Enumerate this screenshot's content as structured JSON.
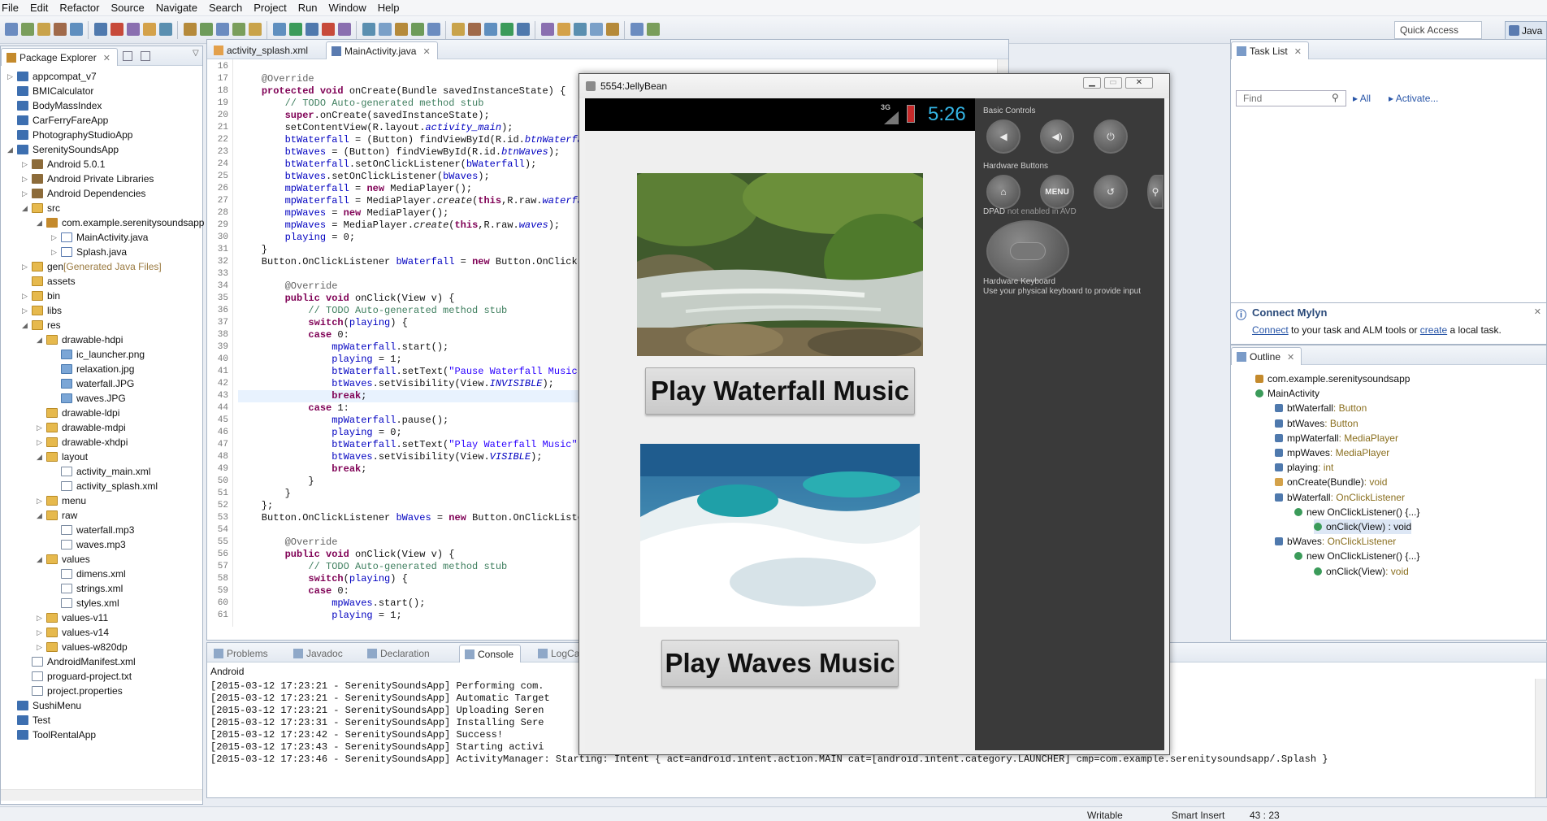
{
  "menubar": [
    "File",
    "Edit",
    "Refactor",
    "Source",
    "Navigate",
    "Search",
    "Project",
    "Run",
    "Window",
    "Help"
  ],
  "toolbar": {
    "quick_access": "Quick Access",
    "perspective": "Java"
  },
  "package_explorer": {
    "title": "Package Explorer",
    "items": [
      {
        "label": "appcompat_v7",
        "depth": 0,
        "icon": "proj",
        "arrow": "▷"
      },
      {
        "label": "BMICalculator",
        "depth": 0,
        "icon": "proj",
        "arrow": ""
      },
      {
        "label": "BodyMassIndex",
        "depth": 0,
        "icon": "proj",
        "arrow": ""
      },
      {
        "label": "CarFerryFareApp",
        "depth": 0,
        "icon": "proj",
        "arrow": ""
      },
      {
        "label": "PhotographyStudioApp",
        "depth": 0,
        "icon": "proj",
        "arrow": ""
      },
      {
        "label": "SerenitySoundsApp",
        "depth": 0,
        "icon": "proj",
        "arrow": "◢"
      },
      {
        "label": "Android 5.0.1",
        "depth": 1,
        "icon": "lib",
        "arrow": "▷"
      },
      {
        "label": "Android Private Libraries",
        "depth": 1,
        "icon": "lib",
        "arrow": "▷"
      },
      {
        "label": "Android Dependencies",
        "depth": 1,
        "icon": "lib",
        "arrow": "▷"
      },
      {
        "label": "src",
        "depth": 1,
        "icon": "folder",
        "arrow": "◢"
      },
      {
        "label": "com.example.serenitysoundsapp",
        "depth": 2,
        "icon": "pkg",
        "arrow": "◢"
      },
      {
        "label": "MainActivity.java",
        "depth": 3,
        "icon": "jfile",
        "arrow": "▷"
      },
      {
        "label": "Splash.java",
        "depth": 3,
        "icon": "jfile",
        "arrow": "▷"
      },
      {
        "label": "gen",
        "suffix": " [Generated Java Files]",
        "depth": 1,
        "icon": "folder",
        "arrow": "▷"
      },
      {
        "label": "assets",
        "depth": 1,
        "icon": "folder",
        "arrow": ""
      },
      {
        "label": "bin",
        "depth": 1,
        "icon": "folder",
        "arrow": "▷"
      },
      {
        "label": "libs",
        "depth": 1,
        "icon": "folder",
        "arrow": "▷"
      },
      {
        "label": "res",
        "depth": 1,
        "icon": "folder",
        "arrow": "◢"
      },
      {
        "label": "drawable-hdpi",
        "depth": 2,
        "icon": "folder",
        "arrow": "◢"
      },
      {
        "label": "ic_launcher.png",
        "depth": 3,
        "icon": "img",
        "arrow": ""
      },
      {
        "label": "relaxation.jpg",
        "depth": 3,
        "icon": "img",
        "arrow": ""
      },
      {
        "label": "waterfall.JPG",
        "depth": 3,
        "icon": "img",
        "arrow": ""
      },
      {
        "label": "waves.JPG",
        "depth": 3,
        "icon": "img",
        "arrow": ""
      },
      {
        "label": "drawable-ldpi",
        "depth": 2,
        "icon": "folder",
        "arrow": ""
      },
      {
        "label": "drawable-mdpi",
        "depth": 2,
        "icon": "folder",
        "arrow": "▷"
      },
      {
        "label": "drawable-xhdpi",
        "depth": 2,
        "icon": "folder",
        "arrow": "▷"
      },
      {
        "label": "layout",
        "depth": 2,
        "icon": "folder",
        "arrow": "◢"
      },
      {
        "label": "activity_main.xml",
        "depth": 3,
        "icon": "file",
        "arrow": ""
      },
      {
        "label": "activity_splash.xml",
        "depth": 3,
        "icon": "file",
        "arrow": ""
      },
      {
        "label": "menu",
        "depth": 2,
        "icon": "folder",
        "arrow": "▷"
      },
      {
        "label": "raw",
        "depth": 2,
        "icon": "folder",
        "arrow": "◢"
      },
      {
        "label": "waterfall.mp3",
        "depth": 3,
        "icon": "file",
        "arrow": ""
      },
      {
        "label": "waves.mp3",
        "depth": 3,
        "icon": "file",
        "arrow": ""
      },
      {
        "label": "values",
        "depth": 2,
        "icon": "folder",
        "arrow": "◢"
      },
      {
        "label": "dimens.xml",
        "depth": 3,
        "icon": "file",
        "arrow": ""
      },
      {
        "label": "strings.xml",
        "depth": 3,
        "icon": "file",
        "arrow": ""
      },
      {
        "label": "styles.xml",
        "depth": 3,
        "icon": "file",
        "arrow": ""
      },
      {
        "label": "values-v11",
        "depth": 2,
        "icon": "folder",
        "arrow": "▷"
      },
      {
        "label": "values-v14",
        "depth": 2,
        "icon": "folder",
        "arrow": "▷"
      },
      {
        "label": "values-w820dp",
        "depth": 2,
        "icon": "folder",
        "arrow": "▷"
      },
      {
        "label": "AndroidManifest.xml",
        "depth": 1,
        "icon": "file",
        "arrow": ""
      },
      {
        "label": "proguard-project.txt",
        "depth": 1,
        "icon": "file",
        "arrow": ""
      },
      {
        "label": "project.properties",
        "depth": 1,
        "icon": "file",
        "arrow": ""
      },
      {
        "label": "SushiMenu",
        "depth": 0,
        "icon": "proj",
        "arrow": ""
      },
      {
        "label": "Test",
        "depth": 0,
        "icon": "proj",
        "arrow": ""
      },
      {
        "label": "ToolRentalApp",
        "depth": 0,
        "icon": "proj",
        "arrow": ""
      }
    ]
  },
  "editor": {
    "tabs": [
      {
        "label": "activity_splash.xml"
      },
      {
        "label": "MainActivity.java"
      }
    ],
    "lines": [
      {
        "n": "16",
        "html": ""
      },
      {
        "n": "17",
        "html": "    <span class='an'>@Override</span>"
      },
      {
        "n": "18",
        "html": "    <span class='kw'>protected void</span> onCreate(Bundle savedInstanceState) {"
      },
      {
        "n": "19",
        "html": "        <span class='cm'>// TODO Auto-generated method stub</span>"
      },
      {
        "n": "20",
        "html": "        <span class='kw'>super</span>.onCreate(savedInstanceState);"
      },
      {
        "n": "21",
        "html": "        setContentView(R.layout.<span class='fld it'>activity_main</span>);"
      },
      {
        "n": "22",
        "html": "        <span class='fld'>btWaterfall</span> = (Button) findViewById(R.id.<span class='fld it'>btnWaterfall</span>);"
      },
      {
        "n": "23",
        "html": "        <span class='fld'>btWaves</span> = (Button) findViewById(R.id.<span class='fld it'>btnWaves</span>);"
      },
      {
        "n": "24",
        "html": "        <span class='fld'>btWaterfall</span>.setOnClickListener(<span class='fld'>bWaterfall</span>);"
      },
      {
        "n": "25",
        "html": "        <span class='fld'>btWaves</span>.setOnClickListener(<span class='fld'>bWaves</span>);"
      },
      {
        "n": "26",
        "html": "        <span class='fld'>mpWaterfall</span> = <span class='kw'>new</span> MediaPlayer();"
      },
      {
        "n": "27",
        "html": "        <span class='fld'>mpWaterfall</span> = MediaPlayer.<span class='it'>create</span>(<span class='kw'>this</span>,R.raw.<span class='fld it'>waterfall</span>);"
      },
      {
        "n": "28",
        "html": "        <span class='fld'>mpWaves</span> = <span class='kw'>new</span> MediaPlayer();"
      },
      {
        "n": "29",
        "html": "        <span class='fld'>mpWaves</span> = MediaPlayer.<span class='it'>create</span>(<span class='kw'>this</span>,R.raw.<span class='fld it'>waves</span>);"
      },
      {
        "n": "30",
        "html": "        <span class='fld'>playing</span> = 0;"
      },
      {
        "n": "31",
        "html": "    }"
      },
      {
        "n": "32",
        "html": "    Button.OnClickListener <span class='fld'>bWaterfall</span> = <span class='kw'>new</span> Button.OnClickListener() {"
      },
      {
        "n": "33",
        "html": ""
      },
      {
        "n": "34",
        "html": "        <span class='an'>@Override</span>"
      },
      {
        "n": "35",
        "html": "        <span class='kw'>public void</span> onClick(View v) {"
      },
      {
        "n": "36",
        "html": "            <span class='cm'>// TODO Auto-generated method stub</span>"
      },
      {
        "n": "37",
        "html": "            <span class='kw'>switch</span>(<span class='fld'>playing</span>) {"
      },
      {
        "n": "38",
        "html": "            <span class='kw'>case</span> 0:"
      },
      {
        "n": "39",
        "html": "                <span class='fld'>mpWaterfall</span>.start();"
      },
      {
        "n": "40",
        "html": "                <span class='fld'>playing</span> = 1;"
      },
      {
        "n": "41",
        "html": "                <span class='fld'>btWaterfall</span>.setText(<span class='str'>\"Pause Waterfall Music\"</span>);"
      },
      {
        "n": "42",
        "html": "                <span class='fld'>btWaves</span>.setVisibility(View.<span class='fld it'>INVISIBLE</span>);"
      },
      {
        "n": "43",
        "html": "                <span class='kw'>break</span>;"
      },
      {
        "n": "44",
        "html": "            <span class='kw'>case</span> 1:"
      },
      {
        "n": "45",
        "html": "                <span class='fld'>mpWaterfall</span>.pause();"
      },
      {
        "n": "46",
        "html": "                <span class='fld'>playing</span> = 0;"
      },
      {
        "n": "47",
        "html": "                <span class='fld'>btWaterfall</span>.setText(<span class='str'>\"Play Waterfall Music\"</span>);"
      },
      {
        "n": "48",
        "html": "                <span class='fld'>btWaves</span>.setVisibility(View.<span class='fld it'>VISIBLE</span>);"
      },
      {
        "n": "49",
        "html": "                <span class='kw'>break</span>;"
      },
      {
        "n": "50",
        "html": "            }"
      },
      {
        "n": "51",
        "html": "        }"
      },
      {
        "n": "52",
        "html": "    };"
      },
      {
        "n": "53",
        "html": "    Button.OnClickListener <span class='fld'>bWaves</span> = <span class='kw'>new</span> Button.OnClickListener() {"
      },
      {
        "n": "54",
        "html": ""
      },
      {
        "n": "55",
        "html": "        <span class='an'>@Override</span>"
      },
      {
        "n": "56",
        "html": "        <span class='kw'>public void</span> onClick(View v) {"
      },
      {
        "n": "57",
        "html": "            <span class='cm'>// TODO Auto-generated method stub</span>"
      },
      {
        "n": "58",
        "html": "            <span class='kw'>switch</span>(<span class='fld'>playing</span>) {"
      },
      {
        "n": "59",
        "html": "            <span class='kw'>case</span> 0:"
      },
      {
        "n": "60",
        "html": "                <span class='fld'>mpWaves</span>.start();"
      },
      {
        "n": "61",
        "html": "                <span class='fld'>playing</span> = 1;"
      }
    ]
  },
  "emulator": {
    "title": "5554:JellyBean",
    "clock": "5:26",
    "network": "3G",
    "button1": "Play Waterfall Music",
    "button2": "Play Waves Music",
    "basic_controls": "Basic Controls",
    "hardware_buttons": "Hardware Buttons",
    "menu_label": "MENU",
    "dpad": "DPAD",
    "dpad_note": " not enabled in AVD",
    "hw_keyboard": "Hardware Keyboard",
    "hw_keyboard_note": "Use your physical keyboard to provide input"
  },
  "tasklist": {
    "title": "Task List",
    "find_placeholder": "Find",
    "all": "All",
    "activate": "Activate..."
  },
  "mylyn": {
    "title": "Connect Mylyn",
    "connect": "Connect",
    "middle": " to your task and ALM tools or ",
    "create": "create",
    "end": " a local task."
  },
  "outline": {
    "title": "Outline",
    "items": [
      {
        "label": "com.example.serenitysoundsapp",
        "type": "",
        "depth": 0,
        "icon": "pkg"
      },
      {
        "label": "MainActivity",
        "type": "",
        "depth": 0,
        "icon": "class"
      },
      {
        "label": "btWaterfall",
        "type": " : Button",
        "depth": 1,
        "icon": "field"
      },
      {
        "label": "btWaves",
        "type": " : Button",
        "depth": 1,
        "icon": "field"
      },
      {
        "label": "mpWaterfall",
        "type": " : MediaPlayer",
        "depth": 1,
        "icon": "field"
      },
      {
        "label": "mpWaves",
        "type": " : MediaPlayer",
        "depth": 1,
        "icon": "field"
      },
      {
        "label": "playing",
        "type": " : int",
        "depth": 1,
        "icon": "field"
      },
      {
        "label": "onCreate(Bundle)",
        "type": " : void",
        "depth": 1,
        "icon": "method"
      },
      {
        "label": "bWaterfall",
        "type": " : OnClickListener",
        "depth": 1,
        "icon": "field"
      },
      {
        "label": "new OnClickListener() {...}",
        "type": "",
        "depth": 2,
        "icon": "class"
      },
      {
        "label": "onClick(View) : void",
        "type": "",
        "depth": 3,
        "icon": "pub",
        "selected": true
      },
      {
        "label": "bWaves",
        "type": " : OnClickListener",
        "depth": 1,
        "icon": "field"
      },
      {
        "label": "new OnClickListener() {...}",
        "type": "",
        "depth": 2,
        "icon": "class"
      },
      {
        "label": "onClick(View)",
        "type": " : void",
        "depth": 3,
        "icon": "pub"
      }
    ]
  },
  "console": {
    "tabs": [
      "Problems",
      "Javadoc",
      "Declaration",
      "Console",
      "LogCat"
    ],
    "header": "Android",
    "lines": [
      "[2015-03-12 17:23:21 - SerenitySoundsApp] Performing com.",
      "[2015-03-12 17:23:21 - SerenitySoundsApp] Automatic Target",
      "[2015-03-12 17:23:21 - SerenitySoundsApp] Uploading Seren",
      "[2015-03-12 17:23:31 - SerenitySoundsApp] Installing Sere",
      "[2015-03-12 17:23:42 - SerenitySoundsApp] Success!",
      "[2015-03-12 17:23:43 - SerenitySoundsApp] Starting activi",
      "[2015-03-12 17:23:46 - SerenitySoundsApp] ActivityManager: Starting: Intent { act=android.intent.action.MAIN cat=[android.intent.category.LAUNCHER] cmp=com.example.serenitysoundsapp/.Splash }"
    ]
  },
  "status": {
    "writable": "Writable",
    "insert": "Smart Insert",
    "position": "43 : 23"
  }
}
